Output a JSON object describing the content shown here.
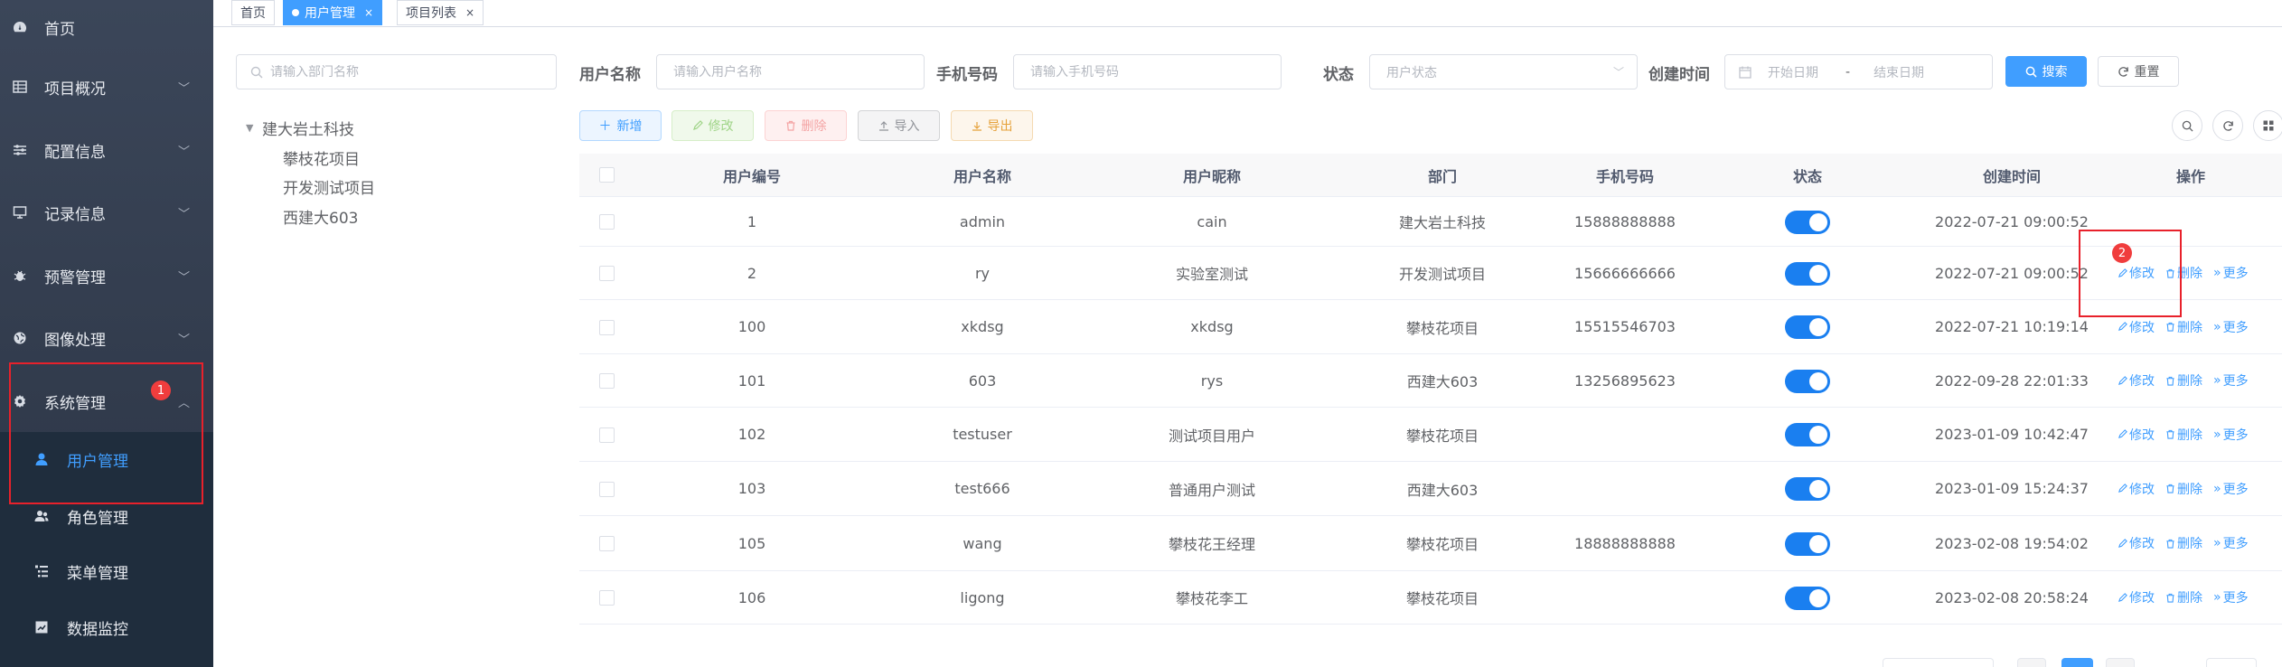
{
  "sidebar": {
    "items": [
      {
        "label": "首页",
        "icon": "dashboard-icon"
      },
      {
        "label": "项目概况",
        "icon": "table-icon"
      },
      {
        "label": "配置信息",
        "icon": "sliders-icon"
      },
      {
        "label": "记录信息",
        "icon": "monitor-icon"
      },
      {
        "label": "预警管理",
        "icon": "bug-icon"
      },
      {
        "label": "图像处理",
        "icon": "globe-icon"
      },
      {
        "label": "系统管理",
        "icon": "gear-icon"
      }
    ],
    "sub_items": [
      {
        "label": "用户管理",
        "icon": "user-icon"
      },
      {
        "label": "角色管理",
        "icon": "users-icon"
      },
      {
        "label": "菜单管理",
        "icon": "tree-list-icon"
      },
      {
        "label": "数据监控",
        "icon": "chart-icon"
      }
    ]
  },
  "annotations": {
    "badge1": "1",
    "badge2": "2"
  },
  "tabs": [
    {
      "label": "首页"
    },
    {
      "label": "用户管理",
      "close": "×"
    },
    {
      "label": "项目列表",
      "close": "×"
    }
  ],
  "dept": {
    "search_placeholder": "请输入部门名称",
    "root": "建大岩土科技",
    "children": [
      "攀枝花项目",
      "开发测试项目",
      "西建大603"
    ]
  },
  "search": {
    "username_label": "用户名称",
    "username_placeholder": "请输入用户名称",
    "phone_label": "手机号码",
    "phone_placeholder": "请输入手机号码",
    "status_label": "状态",
    "status_placeholder": "用户状态",
    "created_label": "创建时间",
    "start_placeholder": "开始日期",
    "separator": "-",
    "end_placeholder": "结束日期",
    "search_button": "搜索",
    "reset_button": "重置"
  },
  "toolbar": {
    "add": "新增",
    "edit": "修改",
    "delete": "删除",
    "import": "导入",
    "export": "导出"
  },
  "table": {
    "columns": [
      "用户编号",
      "用户名称",
      "用户昵称",
      "部门",
      "手机号码",
      "状态",
      "创建时间",
      "操作"
    ],
    "rows": [
      {
        "id": "1",
        "name": "admin",
        "nick": "cain",
        "dept": "建大岩土科技",
        "phone": "15888888888",
        "status": true,
        "created": "2022-07-21 09:00:52"
      },
      {
        "id": "2",
        "name": "ry",
        "nick": "实验室测试",
        "dept": "开发测试项目",
        "phone": "15666666666",
        "status": true,
        "created": "2022-07-21 09:00:52"
      },
      {
        "id": "100",
        "name": "xkdsg",
        "nick": "xkdsg",
        "dept": "攀枝花项目",
        "phone": "15515546703",
        "status": true,
        "created": "2022-07-21 10:19:14"
      },
      {
        "id": "101",
        "name": "603",
        "nick": "rys",
        "dept": "西建大603",
        "phone": "13256895623",
        "status": true,
        "created": "2022-09-28 22:01:33"
      },
      {
        "id": "102",
        "name": "testuser",
        "nick": "测试项目用户",
        "dept": "攀枝花项目",
        "phone": "",
        "status": true,
        "created": "2023-01-09 10:42:47"
      },
      {
        "id": "103",
        "name": "test666",
        "nick": "普通用户测试",
        "dept": "西建大603",
        "phone": "",
        "status": true,
        "created": "2023-01-09 15:24:37"
      },
      {
        "id": "105",
        "name": "wang",
        "nick": "攀枝花王经理",
        "dept": "攀枝花项目",
        "phone": "18888888888",
        "status": true,
        "created": "2023-02-08 19:54:02"
      },
      {
        "id": "106",
        "name": "ligong",
        "nick": "攀枝花李工",
        "dept": "攀枝花项目",
        "phone": "",
        "status": true,
        "created": "2023-02-08 20:58:24"
      }
    ],
    "op_edit": "修改",
    "op_delete": "删除",
    "op_more": "更多"
  },
  "colors": {
    "primary": "#409eff",
    "sidebar": "#304156",
    "annotation": "#e8212b"
  }
}
